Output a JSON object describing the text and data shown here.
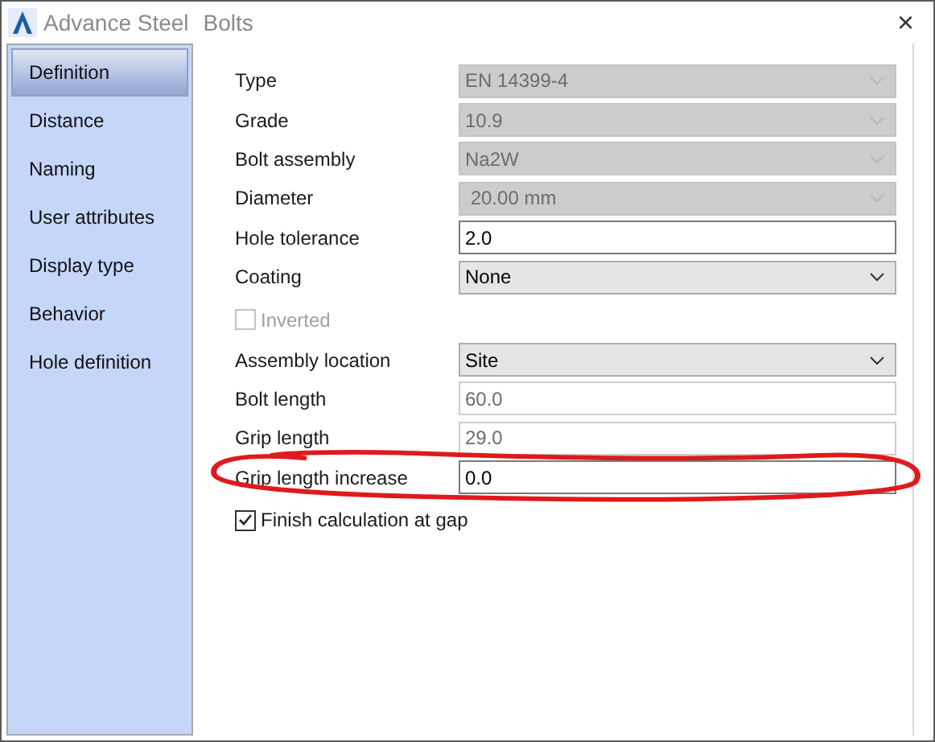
{
  "window": {
    "title": "Advance Steel",
    "subtitle": "Bolts",
    "close": "×"
  },
  "sidebar": {
    "items": [
      {
        "label": "Definition",
        "selected": true
      },
      {
        "label": "Distance",
        "selected": false
      },
      {
        "label": "Naming",
        "selected": false
      },
      {
        "label": "User attributes",
        "selected": false
      },
      {
        "label": "Display type",
        "selected": false
      },
      {
        "label": "Behavior",
        "selected": false
      },
      {
        "label": "Hole definition",
        "selected": false
      }
    ]
  },
  "fields": [
    {
      "kind": "combo",
      "label": "Type",
      "value": "EN 14399-4",
      "disabled": true
    },
    {
      "kind": "combo",
      "label": "Grade",
      "value": "10.9",
      "disabled": true
    },
    {
      "kind": "combo",
      "label": "Bolt assembly",
      "value": "Na2W",
      "disabled": true
    },
    {
      "kind": "combo",
      "label": "Diameter",
      "value": " 20.00 mm",
      "disabled": true
    },
    {
      "kind": "text",
      "label": "Hole tolerance",
      "value": "2.0",
      "disabled": false
    },
    {
      "kind": "combo",
      "label": "Coating",
      "value": "None",
      "disabled": false
    },
    {
      "kind": "checkbox",
      "label": "Inverted",
      "checked": false,
      "disabled": true
    },
    {
      "kind": "combo",
      "label": "Assembly location",
      "value": "Site",
      "disabled": false
    },
    {
      "kind": "text",
      "label": "Bolt length",
      "value": "60.0",
      "disabled": true
    },
    {
      "kind": "text",
      "label": "Grip length",
      "value": "29.0",
      "disabled": true
    },
    {
      "kind": "text",
      "label": "Grip length increase",
      "value": "0.0",
      "disabled": false
    },
    {
      "kind": "checkbox",
      "label": "Finish calculation at gap",
      "checked": true,
      "disabled": false
    }
  ]
}
